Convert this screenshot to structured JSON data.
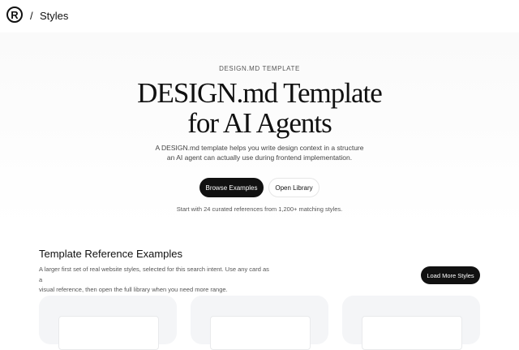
{
  "nav": {
    "logo_glyph": "R",
    "separator": "/",
    "current": "Styles"
  },
  "hero": {
    "eyebrow": "DESIGN.MD TEMPLATE",
    "title_line1": "DESIGN.md Template",
    "title_line2": "for AI Agents",
    "subtitle_line1": "A DESIGN.md template helps you write design context in a structure",
    "subtitle_line2": "an AI agent can actually use during frontend implementation.",
    "primary_button": "Browse Examples",
    "secondary_button": "Open Library",
    "hint": "Start with 24 curated references from 1,200+ matching styles."
  },
  "examples": {
    "title": "Template Reference Examples",
    "desc_line1": "A larger first set of real website styles, selected for this search intent. Use any card as a",
    "desc_line2": "visual reference, then open the full library when you need more range.",
    "load_more": "Load More Styles"
  }
}
